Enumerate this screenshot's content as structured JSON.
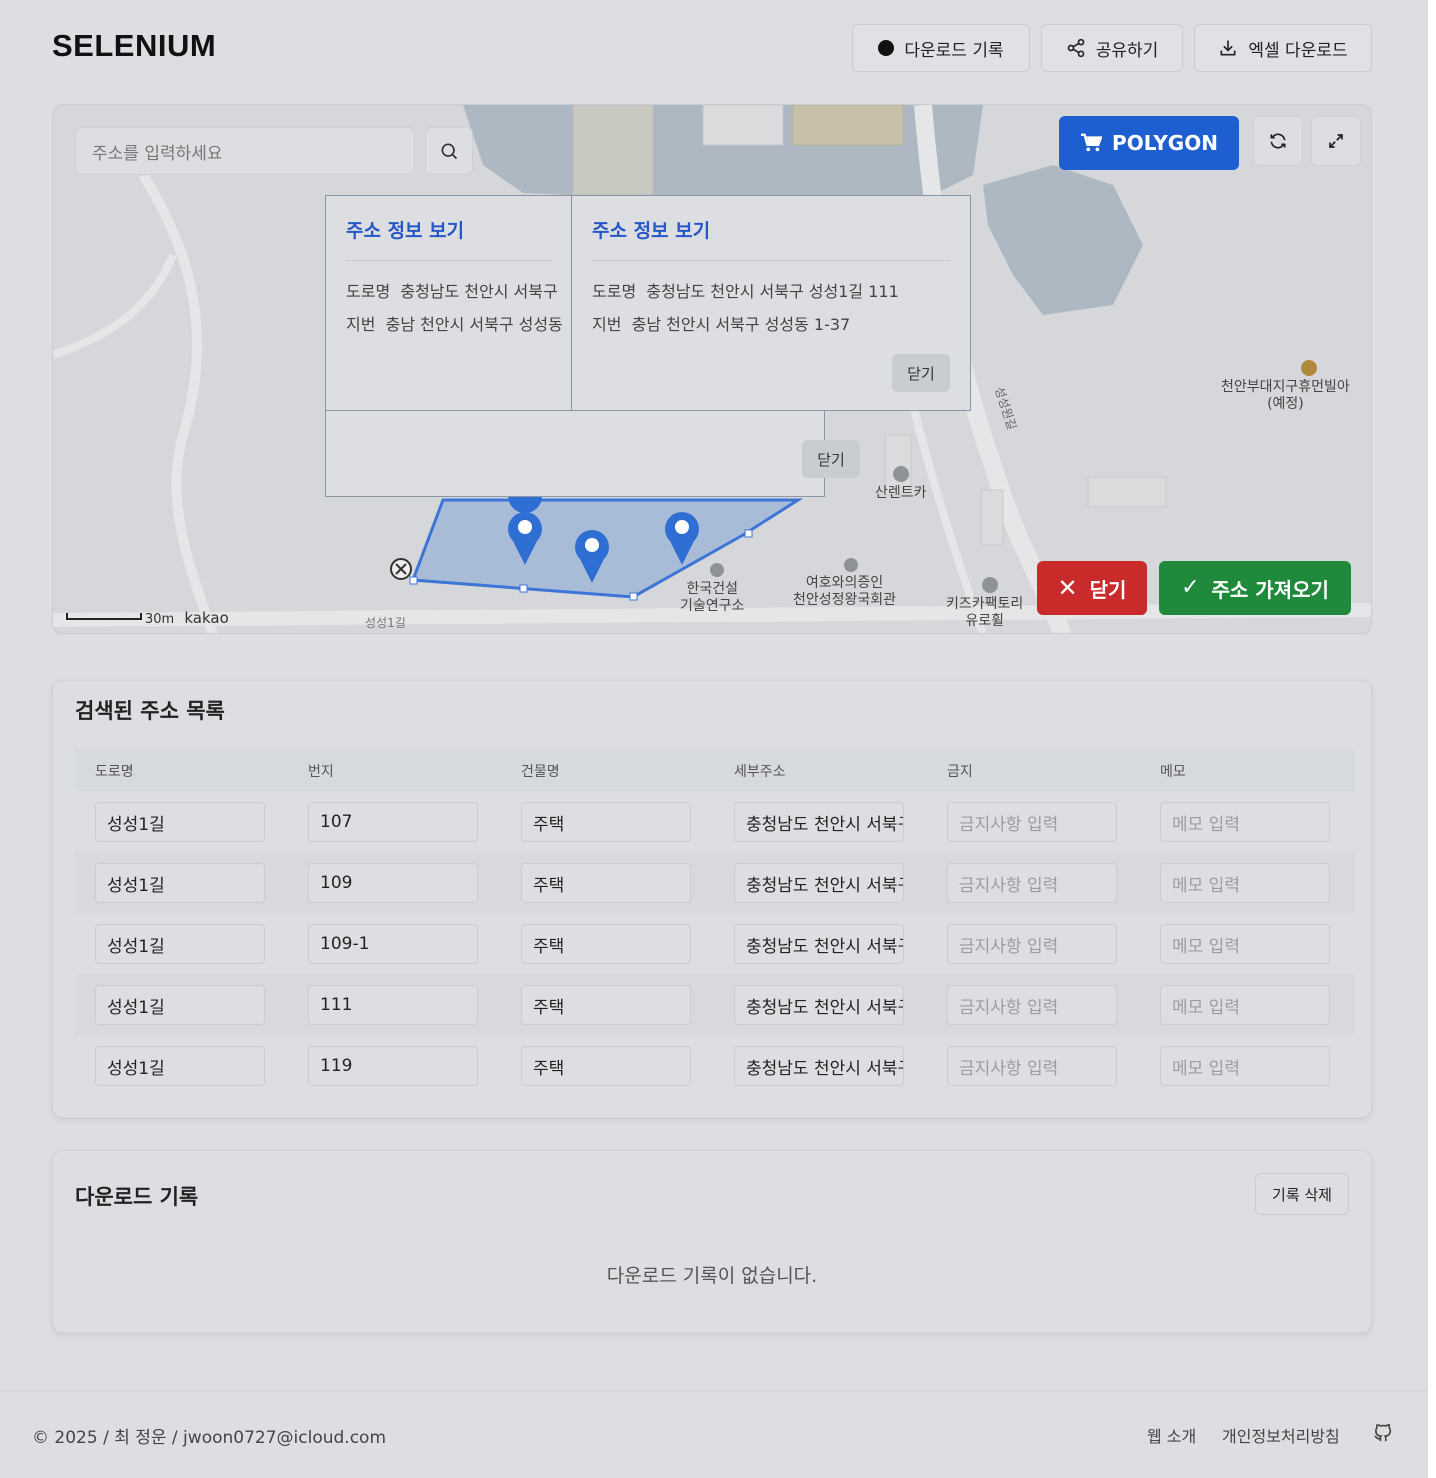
{
  "header": {
    "brand": "SELENIUM",
    "history_label": "다운로드 기록",
    "share_label": "공유하기",
    "excel_label": "엑셀 다운로드"
  },
  "map": {
    "search_placeholder": "주소를 입력하세요",
    "polygon_label": "POLYGON",
    "close_label": "닫기",
    "fetch_label": "주소 가져오기",
    "scale": "30m",
    "provider": "kakao",
    "popups": [
      {
        "title": "주소 정보 보기",
        "road_label": "도로명",
        "road_value": "충청남도 천안시 서북구",
        "jibun_label": "지번",
        "jibun_value": "충남 천안시 서북구 성성동"
      },
      {
        "title": "주소 정보 보기",
        "road_label": "도로명",
        "road_value": "충청남도 천안시 서북구 성성1길 111",
        "jibun_label": "지번",
        "jibun_value": "충남 천안시 서북구 성성동 1-37",
        "close": "닫기"
      }
    ],
    "back_popup_close": "닫기",
    "places": {
      "p1a": "천안부대지구휴먼빌아",
      "p1b": "(예정)",
      "p2": "산렌트카",
      "p3a": "한국건설",
      "p3b": "기술연구소",
      "p4a": "여호와의증인",
      "p4b": "천안성정왕국회관",
      "p5a": "키즈카팩토리",
      "p5b": "유로휠",
      "road1": "성성1길",
      "road2": "성성원길"
    }
  },
  "address_list": {
    "title": "검색된 주소 목록",
    "columns": [
      "도로명",
      "번지",
      "건물명",
      "세부주소",
      "금지",
      "메모"
    ],
    "rows": [
      {
        "road": "성성1길",
        "num": "107",
        "building": "주택",
        "detail": "충청남도 천안시 서북구",
        "ban_ph": "금지사항 입력",
        "memo_ph": "메모 입력"
      },
      {
        "road": "성성1길",
        "num": "109",
        "building": "주택",
        "detail": "충청남도 천안시 서북구",
        "ban_ph": "금지사항 입력",
        "memo_ph": "메모 입력"
      },
      {
        "road": "성성1길",
        "num": "109-1",
        "building": "주택",
        "detail": "충청남도 천안시 서북구",
        "ban_ph": "금지사항 입력",
        "memo_ph": "메모 입력"
      },
      {
        "road": "성성1길",
        "num": "111",
        "building": "주택",
        "detail": "충청남도 천안시 서북구",
        "ban_ph": "금지사항 입력",
        "memo_ph": "메모 입력"
      },
      {
        "road": "성성1길",
        "num": "119",
        "building": "주택",
        "detail": "충청남도 천안시 서북구",
        "ban_ph": "금지사항 입력",
        "memo_ph": "메모 입력"
      }
    ]
  },
  "download_history": {
    "title": "다운로드 기록",
    "delete_label": "기록 삭제",
    "empty_text": "다운로드 기록이 없습니다."
  },
  "footer": {
    "copyright": "© 2025 / 최 정운 / jwoon0727@icloud.com",
    "about": "웹 소개",
    "privacy": "개인정보처리방침"
  },
  "colors": {
    "polygon_button": "#1d5fd0",
    "close_button": "#c92b2b",
    "fetch_button": "#1f8a3b",
    "popup_title": "#2557c8"
  }
}
